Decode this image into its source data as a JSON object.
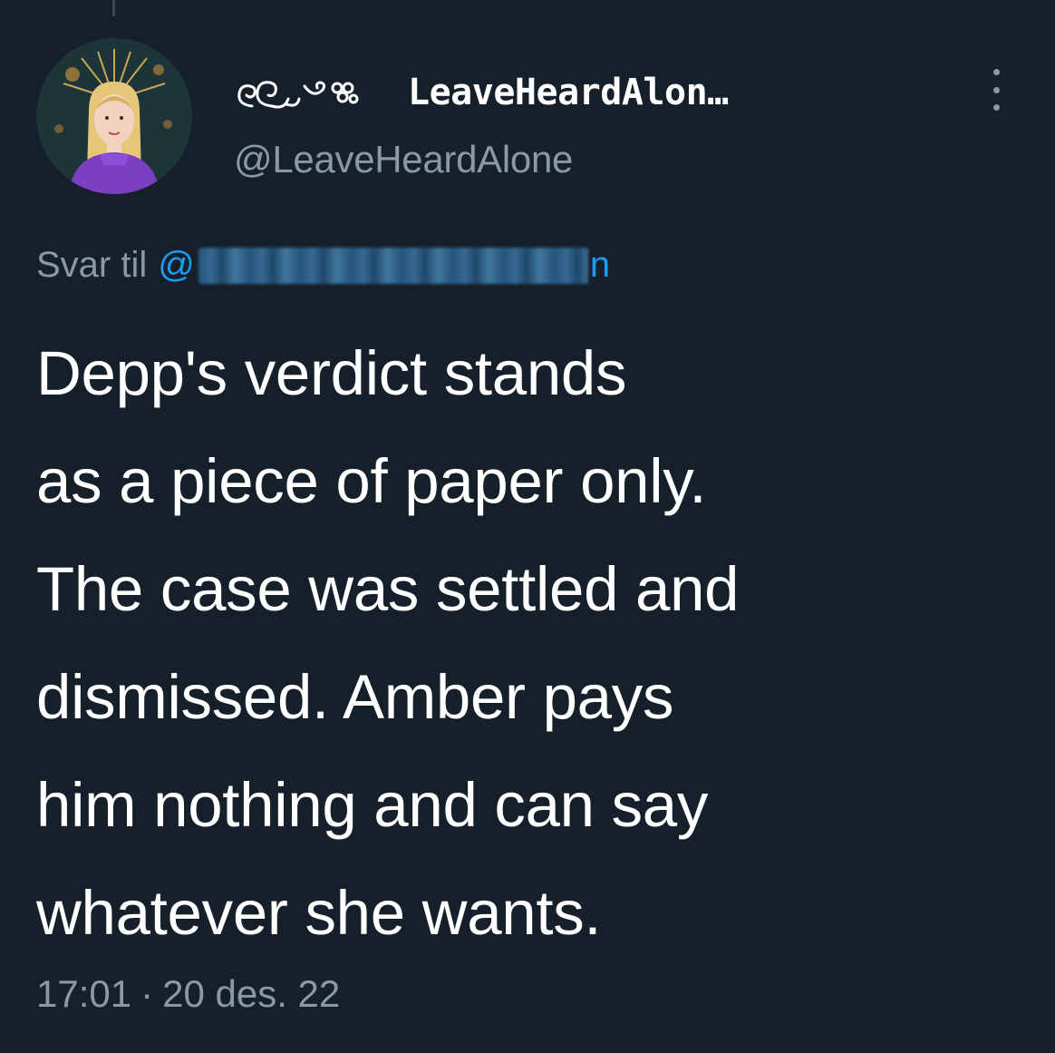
{
  "tweet": {
    "author": {
      "display_name_ornament_icon": "swirl-ornament-icon",
      "display_name": "LeaveHeardAlon…",
      "handle": "@LeaveHeardAlone"
    },
    "reply": {
      "prefix": "Svar til",
      "mention_at": "@",
      "mention_tail": "n"
    },
    "text_lines": [
      "Depp's verdict stands",
      "as a piece of paper only.",
      "The case was settled and",
      "dismissed. Amber pays",
      "him nothing and can say",
      "whatever she wants."
    ],
    "time": "17:01",
    "separator": "·",
    "date": "20 des. 22"
  },
  "colors": {
    "background": "#15202b",
    "primary_text": "#ffffff",
    "secondary_text": "#8b98a5",
    "link": "#1d9bf0"
  }
}
